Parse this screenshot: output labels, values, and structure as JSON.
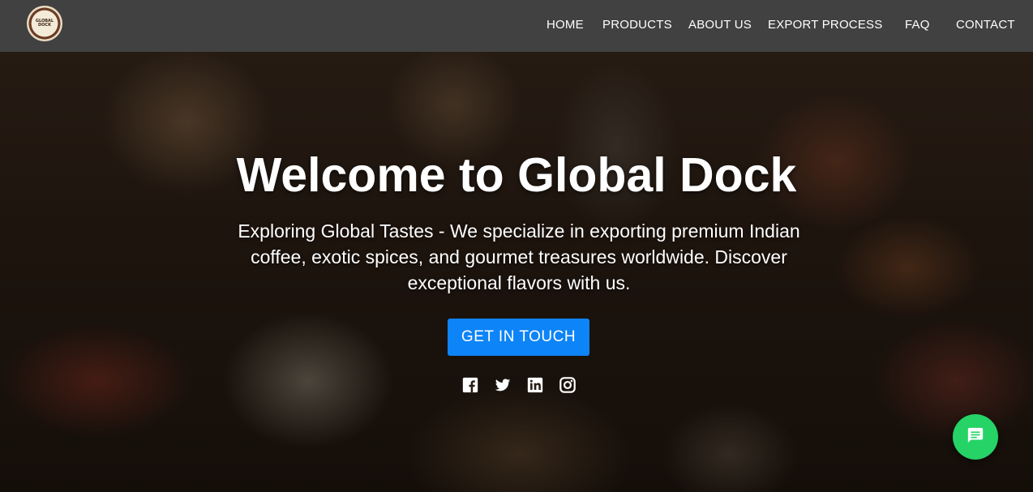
{
  "brand": {
    "logo_text": "GLOBAL DOCK",
    "logo_icon": "global-dock-logo"
  },
  "nav": {
    "items": [
      {
        "label": "HOME"
      },
      {
        "label": "PRODUCTS"
      },
      {
        "label": "ABOUT US"
      },
      {
        "label": "EXPORT PROCESS"
      },
      {
        "label": "FAQ"
      },
      {
        "label": "CONTACT"
      }
    ]
  },
  "hero": {
    "title": "Welcome to Global Dock",
    "subtitle": "Exploring Global Tastes - We specialize in exporting premium Indian coffee, exotic spices, and gourmet treasures worldwide. Discover exceptional flavors with us.",
    "cta_label": "GET IN TOUCH"
  },
  "social": [
    {
      "icon": "facebook-icon"
    },
    {
      "icon": "twitter-icon"
    },
    {
      "icon": "linkedin-icon"
    },
    {
      "icon": "instagram-icon"
    }
  ],
  "chat": {
    "icon": "chat-bubble-icon"
  },
  "colors": {
    "navbar_bg": "#414141",
    "cta_bg": "#0d84f7",
    "chat_bg": "#25d366",
    "text": "#ffffff"
  }
}
